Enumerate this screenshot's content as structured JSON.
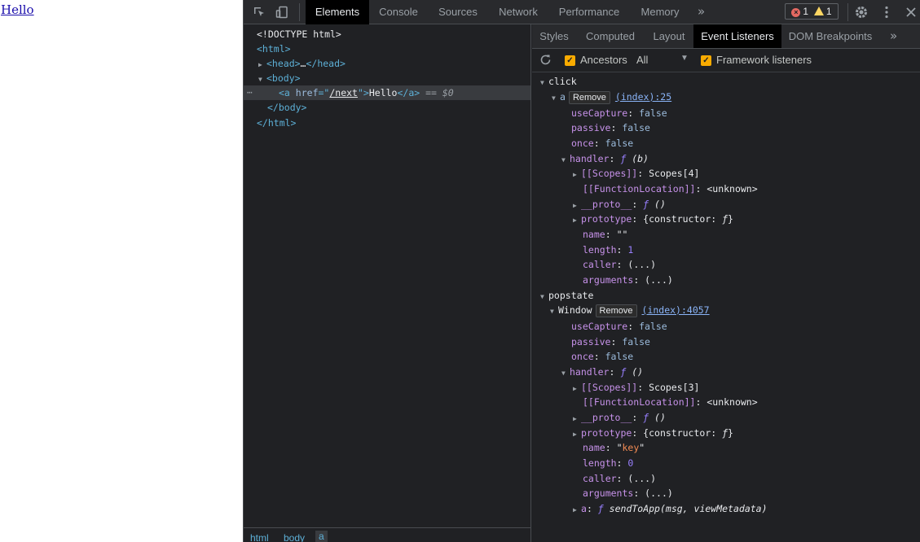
{
  "page": {
    "link_text": "Hello"
  },
  "devtools": {
    "tabs": [
      "Elements",
      "Console",
      "Sources",
      "Network",
      "Performance",
      "Memory"
    ],
    "more": "»",
    "errors": "1",
    "warnings": "1",
    "elements": {
      "doctype": "<!DOCTYPE html>",
      "html_open": "<html>",
      "head_open": "<head>",
      "head_ellipsis": "…",
      "head_close": "</head>",
      "body_open": "<body>",
      "a_open_tag": "<a",
      "a_attr_name": "href",
      "a_attr_eq": "=\"",
      "a_attr_value": "/next",
      "a_attr_end": "\">",
      "a_text": "Hello",
      "a_close": "</a>",
      "a_marker": "== $0",
      "body_close": "</body>",
      "html_close": "</html>"
    },
    "breadcrumb": [
      "html",
      "body",
      "a"
    ],
    "sidebar_tabs": [
      "Styles",
      "Computed",
      "Layout",
      "Event Listeners",
      "DOM Breakpoints"
    ],
    "sidebar_more": "»",
    "toolbar": {
      "ancestors": "Ancestors",
      "filter_value": "All",
      "framework": "Framework listeners"
    },
    "listeners": {
      "click": {
        "event": "click",
        "target": "a",
        "remove": "Remove",
        "location": "(index):25",
        "use_capture": "false",
        "passive": "false",
        "once": "false",
        "handler_sig": "(b)",
        "scopes": "Scopes[4]",
        "function_location": "<unknown>",
        "proto": "()",
        "prototype": "{constructor: ",
        "prototype_f": "ƒ",
        "prototype_end": "}",
        "name": "\"\"",
        "length": "1",
        "caller": "(...)",
        "arguments": "(...)"
      },
      "popstate": {
        "event": "popstate",
        "target": "Window",
        "remove": "Remove",
        "location": "(index):4057",
        "use_capture": "false",
        "passive": "false",
        "once": "false",
        "handler_sig": "()",
        "scopes": "Scopes[3]",
        "function_location": "<unknown>",
        "proto": "()",
        "prototype": "{constructor: ",
        "prototype_f": "ƒ",
        "prototype_end": "}",
        "name_q1": "\"",
        "name_val": "key",
        "name_q2": "\"",
        "length": "0",
        "caller": "(...)",
        "arguments": "(...)",
        "a_sig": "sendToApp(msg, viewMetadata)"
      }
    },
    "labels": {
      "use_capture": "useCapture",
      "passive": "passive",
      "once": "once",
      "handler": "handler",
      "scopes": "[[Scopes]]",
      "function_location": "[[FunctionLocation]]",
      "proto": "__proto__",
      "prototype": "prototype",
      "name": "name",
      "length": "length",
      "caller": "caller",
      "arguments": "arguments",
      "a": "a",
      "f": "ƒ",
      "colon": ": "
    }
  }
}
